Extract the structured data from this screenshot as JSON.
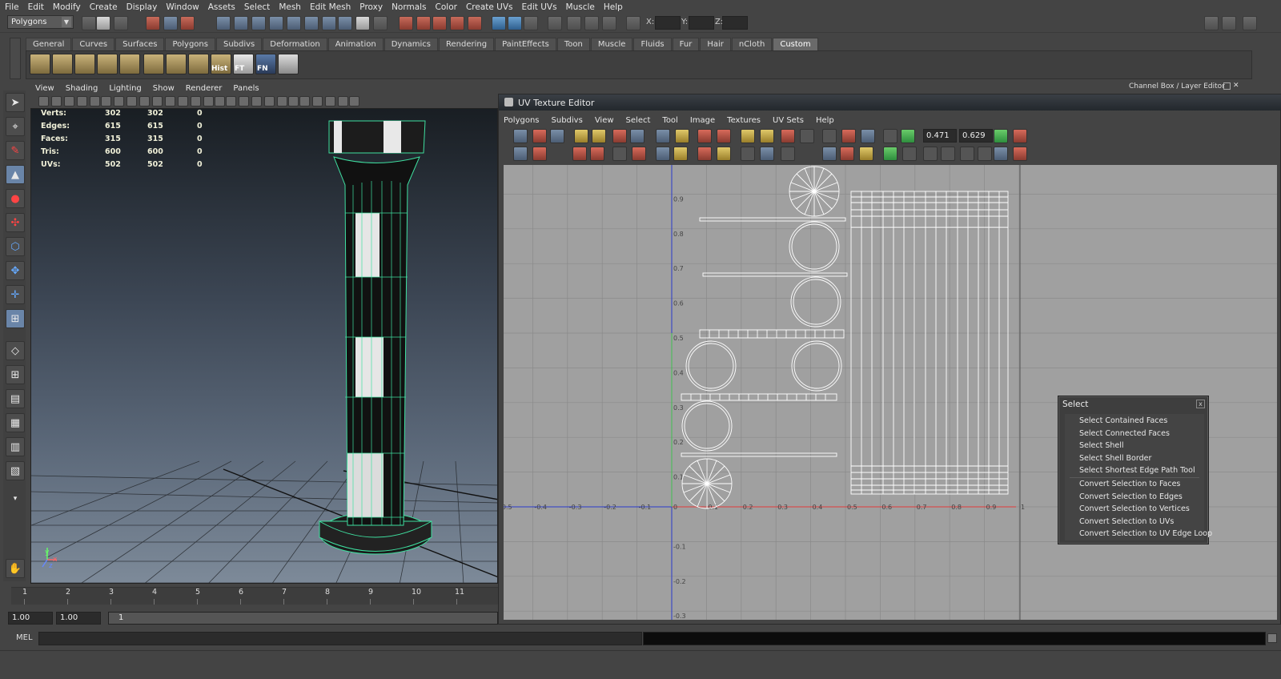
{
  "main_menu": [
    "File",
    "Edit",
    "Modify",
    "Create",
    "Display",
    "Window",
    "Assets",
    "Select",
    "Mesh",
    "Edit Mesh",
    "Proxy",
    "Normals",
    "Color",
    "Create UVs",
    "Edit UVs",
    "Muscle",
    "Help"
  ],
  "status_line": {
    "mode": "Polygons",
    "x_label": "X:",
    "y_label": "Y:",
    "z_label": "Z:"
  },
  "shelf": {
    "tabs": [
      "General",
      "Curves",
      "Surfaces",
      "Polygons",
      "Subdivs",
      "Deformation",
      "Animation",
      "Dynamics",
      "Rendering",
      "PaintEffects",
      "Toon",
      "Muscle",
      "Fluids",
      "Fur",
      "Hair",
      "nCloth",
      "Custom"
    ],
    "active_tab": "Custom",
    "button_labels": [
      "Hist",
      "FT",
      "FN"
    ]
  },
  "viewport": {
    "menu": [
      "View",
      "Shading",
      "Lighting",
      "Show",
      "Renderer",
      "Panels"
    ],
    "hud": [
      {
        "label": "Verts:",
        "v1": "302",
        "v2": "302",
        "v3": "0"
      },
      {
        "label": "Edges:",
        "v1": "615",
        "v2": "615",
        "v3": "0"
      },
      {
        "label": "Faces:",
        "v1": "315",
        "v2": "315",
        "v3": "0"
      },
      {
        "label": "Tris:",
        "v1": "600",
        "v2": "600",
        "v3": "0"
      },
      {
        "label": "UVs:",
        "v1": "502",
        "v2": "502",
        "v3": "0"
      }
    ],
    "axis_x": "x",
    "axis_y": "y",
    "axis_z": "z"
  },
  "time_slider": {
    "ticks": [
      "1",
      "2",
      "3",
      "4",
      "5",
      "6",
      "7",
      "8",
      "9",
      "10",
      "11"
    ]
  },
  "range_slider": {
    "start": "1.00",
    "current": "1.00",
    "frame": "1"
  },
  "command_line": {
    "label": "MEL"
  },
  "channel_box": {
    "title": "Channel Box / Layer Editor"
  },
  "uv_editor": {
    "title": "UV Texture Editor",
    "menu": [
      "Polygons",
      "Subdivs",
      "View",
      "Select",
      "Tool",
      "Image",
      "Textures",
      "UV Sets",
      "Help"
    ],
    "u_value": "0.471",
    "v_value": "0.629",
    "v_labels": [
      "0.9",
      "0.8",
      "0.7",
      "0.6",
      "0.5",
      "0.4",
      "0.3",
      "0.2",
      "0.1",
      "-0.1",
      "-0.2",
      "-0.3"
    ],
    "u_labels": [
      "-0.5",
      "-0.4",
      "-0.3",
      "-0.2",
      "-0.1",
      "0",
      "0.1",
      "0.2",
      "0.3",
      "0.4",
      "0.5",
      "0.6",
      "0.7",
      "0.8",
      "0.9",
      "1"
    ]
  },
  "select_popup": {
    "title": "Select",
    "close": "x",
    "items": [
      "Select Contained Faces",
      "Select Connected Faces",
      "Select Shell",
      "Select Shell Border",
      "Select Shortest Edge Path Tool",
      "Convert Selection to Faces",
      "Convert Selection to Edges",
      "Convert Selection to Vertices",
      "Convert Selection to UVs",
      "Convert Selection to UV Edge Loop"
    ]
  },
  "colors": {
    "wireframe": "#3fe0a0",
    "uv_background": "#a0a0a0",
    "u_axis": "#e23a3a",
    "v_axis": "#2a3acc"
  }
}
